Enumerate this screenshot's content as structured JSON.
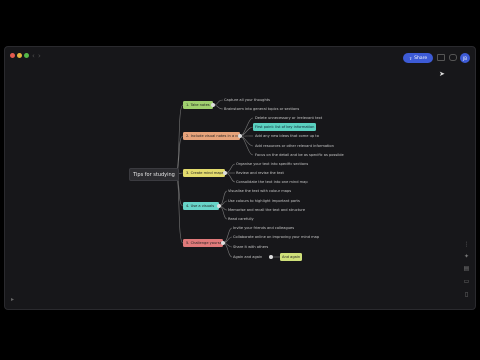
{
  "toolbar": {
    "share_label": "Share",
    "avatar_initials": "JB"
  },
  "colors": {
    "window_bg": "#17171a",
    "accent_blue": "#3d5bd6",
    "branch_green": "#9fd06e",
    "branch_orange": "#e6a27a",
    "branch_yellow": "#e3db6d",
    "branch_teal": "#67d4c8",
    "branch_red": "#e07a7a",
    "highlight_teal": "#5ad1c0",
    "highlight_yellow": "#cfe07a"
  },
  "mindmap": {
    "root": "Tips for studying",
    "branches": [
      {
        "label": "1. Take notes",
        "leaves": [
          "Capture all your thoughts",
          "Brainstorm into general topics or sections"
        ]
      },
      {
        "label": "2. Include visual notes in a concept",
        "leaves": [
          "Delete unnecessary or irrelevant text",
          "First point: list of key information",
          "Add any new ideas that come up to",
          "Add resources or other relevant information",
          "Focus on the detail and be as specific as possible"
        ]
      },
      {
        "label": "3. Create mind maps",
        "leaves": [
          "Organise your text into specific sections",
          "Review and revise the text",
          "Consolidate the text into one mind map"
        ]
      },
      {
        "label": "4. Use a visuals",
        "leaves": [
          "Visualise the text with colour maps",
          "Use colours to highlight important parts",
          "Memorise and recall the text and structure",
          "Read carefully"
        ]
      },
      {
        "label": "5. Challenge yourself",
        "leaves": [
          "Invite your friends and colleagues",
          "Collaborate online on improving your mind map",
          "Share it with others",
          "Again and again",
          "And again"
        ]
      }
    ]
  }
}
